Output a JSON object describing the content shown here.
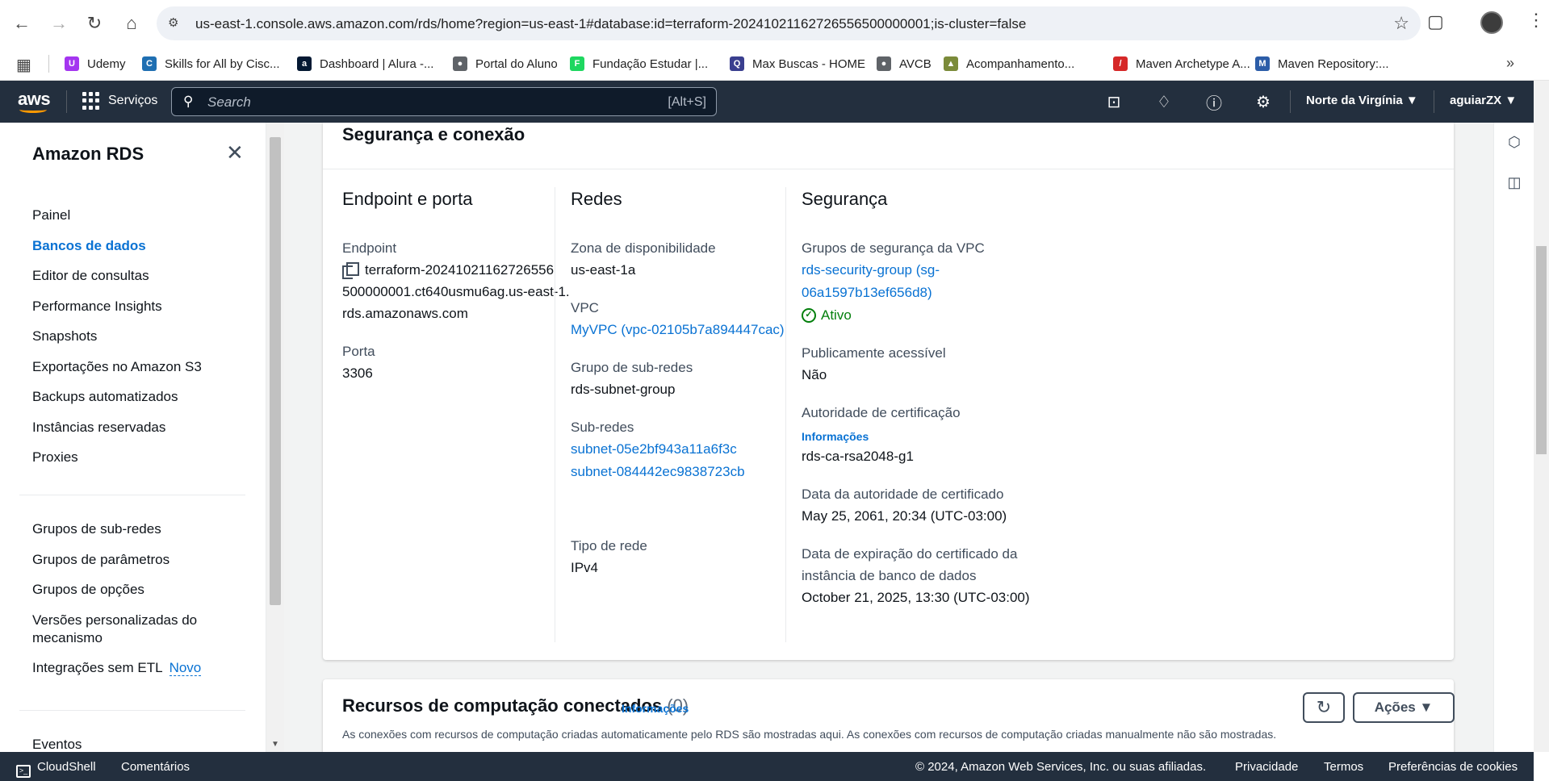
{
  "browser": {
    "url": "us-east-1.console.aws.amazon.com/rds/home?region=us-east-1#database:id=terraform-20241021162726556500000001;is-cluster=false",
    "bookmarks": [
      {
        "label": "Udemy",
        "color": "#a435f0",
        "glyph": "U"
      },
      {
        "label": "Skills for All by Cisc...",
        "color": "#1f6fb2",
        "glyph": "C"
      },
      {
        "label": "Dashboard | Alura -...",
        "color": "#051933",
        "glyph": "a"
      },
      {
        "label": "Portal do Aluno",
        "color": "#5f6368",
        "glyph": "●"
      },
      {
        "label": "Fundação Estudar |...",
        "color": "#1ed760",
        "glyph": "F"
      },
      {
        "label": "Max Buscas - HOME",
        "color": "#3a3f8f",
        "glyph": "Q"
      },
      {
        "label": "AVCB",
        "color": "#5f6368",
        "glyph": "●"
      },
      {
        "label": "Acompanhamento...",
        "color": "#7b8b3a",
        "glyph": "▲"
      },
      {
        "label": "Maven Archetype A...",
        "color": "#d62828",
        "glyph": "/"
      },
      {
        "label": "Maven Repository:...",
        "color": "#2c5da8",
        "glyph": "M"
      }
    ]
  },
  "topnav": {
    "logo": "aws",
    "services": "Serviços",
    "search_placeholder": "Search",
    "search_shortcut": "[Alt+S]",
    "region": "Norte da Virgínia ▼",
    "user": "aguiarZX ▼"
  },
  "sidebar": {
    "title": "Amazon RDS",
    "items": [
      {
        "label": "Painel",
        "active": false
      },
      {
        "label": "Bancos de dados",
        "active": true
      },
      {
        "label": "Editor de consultas",
        "active": false
      },
      {
        "label": "Performance Insights",
        "active": false
      },
      {
        "label": "Snapshots",
        "active": false
      },
      {
        "label": "Exportações no Amazon S3",
        "active": false
      },
      {
        "label": "Backups automatizados",
        "active": false
      },
      {
        "label": "Instâncias reservadas",
        "active": false
      },
      {
        "label": "Proxies",
        "active": false
      }
    ],
    "items2": [
      "Grupos de sub-redes",
      "Grupos de parâmetros",
      "Grupos de opções",
      "Versões personalizadas do mecanismo",
      "Integrações sem ETL"
    ],
    "new_badge": "Novo",
    "item_bottom": "Eventos"
  },
  "security_card": {
    "title": "Segurança e conexão",
    "endpoint_col": {
      "title": "Endpoint e porta",
      "endpoint_label": "Endpoint",
      "endpoint_line1": "terraform-20241021162726556",
      "endpoint_line2": "500000001.ct640usmu6ag.us-east-1.",
      "endpoint_line3": "rds.amazonaws.com",
      "port_label": "Porta",
      "port_value": "3306"
    },
    "network_col": {
      "title": "Redes",
      "az_label": "Zona de disponibilidade",
      "az_value": "us-east-1a",
      "vpc_label": "VPC",
      "vpc_value": "MyVPC (vpc-02105b7a894447cac)",
      "subnet_group_label": "Grupo de sub-redes",
      "subnet_group_value": "rds-subnet-group",
      "subnets_label": "Sub-redes",
      "subnet_1": "subnet-05e2bf943a11a6f3c",
      "subnet_2": "subnet-084442ec9838723cb",
      "net_type_label": "Tipo de rede",
      "net_type_value": "IPv4"
    },
    "security_col": {
      "title": "Segurança",
      "sg_label": "Grupos de segurança da VPC",
      "sg_line1": "rds-security-group (sg-",
      "sg_line2": "06a1597b13ef656d8)",
      "sg_status": "Ativo",
      "public_label": "Publicamente acessível",
      "public_value": "Não",
      "ca_label": "Autoridade de certificação",
      "ca_info": "Informações",
      "ca_value": "rds-ca-rsa2048-g1",
      "ca_date_label": "Data da autoridade de certificado",
      "ca_date_value": "May 25, 2061, 20:34 (UTC-03:00)",
      "cert_exp_label_1": "Data de expiração do certificado da",
      "cert_exp_label_2": "instância de banco de dados",
      "cert_exp_value": "October 21, 2025, 13:30 (UTC-03:00)"
    }
  },
  "connected_card": {
    "title": "Recursos de computação conectados",
    "count": "(0)",
    "info": "Informações",
    "actions_label": "Ações ▼",
    "description": "As conexões com recursos de computação criadas automaticamente pelo RDS são mostradas aqui. As conexões com recursos de computação criadas manualmente não são mostradas."
  },
  "footer": {
    "cloudshell": "CloudShell",
    "comments": "Comentários",
    "copyright": "© 2024, Amazon Web Services, Inc. ou suas afiliadas.",
    "privacy": "Privacidade",
    "terms": "Termos",
    "cookies": "Preferências de cookies"
  },
  "colors": {
    "aws_nav": "#232f3e",
    "link": "#0972d3",
    "success": "#037f0c",
    "accent": "#ff9900"
  }
}
